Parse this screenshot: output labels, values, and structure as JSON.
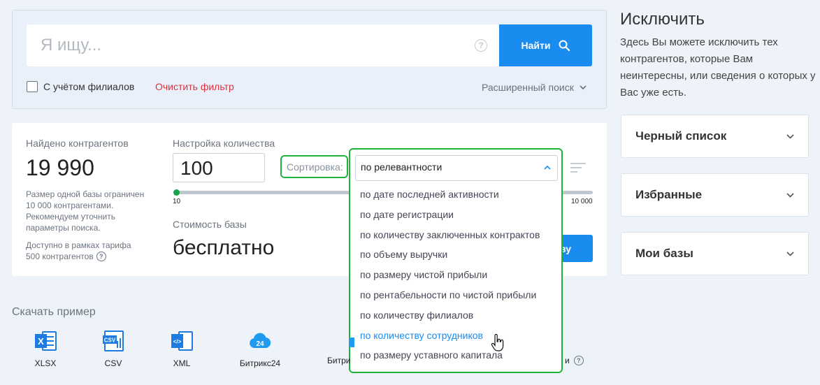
{
  "search": {
    "placeholder": "Я ищу...",
    "button_label": "Найти",
    "branches_label": "С учётом филиалов",
    "clear_filter_label": "Очистить фильтр",
    "advanced_label": "Расширенный поиск"
  },
  "results": {
    "found_label": "Найдено контрагентов",
    "found_count": "19 990",
    "limit_note": [
      "Размер одной базы ограничен",
      "10 000 контрагентами.",
      "Рекомендуем уточнить",
      "параметры поиска."
    ],
    "tariff_note": [
      "Доступно в рамках тарифа",
      "500 контрагентов"
    ],
    "qty_label": "Настройка количества",
    "qty_value": "100",
    "slider_min": "10",
    "slider_max": "10 000",
    "cost_label": "Стоимость базы",
    "cost_value": "бесплатно",
    "partial_button_text": "зу"
  },
  "sort": {
    "label": "Сортировка:",
    "selected": "по релевантности",
    "options": [
      "по дате последней активности",
      "по дате регистрации",
      "по количеству заключенных контрактов",
      "по объему выручки",
      "по размеру чистой прибыли",
      "по рентабельности по чистой прибыли",
      "по количеству филиалов",
      "по количеству сотрудников",
      "по размеру уставного капитала"
    ],
    "highlighted_index": 7,
    "highlight_color": "#1a8cf0"
  },
  "downloads": {
    "title": "Скачать пример",
    "items": [
      "XLSX",
      "CSV",
      "XML",
      "Битрикс24"
    ],
    "partial_left": "Битри",
    "partial_right": "и"
  },
  "exclude": {
    "title": "Исключить",
    "description": "Здесь Вы можете исключить тех контрагентов, которые Вам неинтересны, или сведения о которых у Вас уже есть.",
    "sections": [
      "Черный список",
      "Избранные",
      "Мои базы"
    ]
  },
  "colors": {
    "accent": "#1a8cf0",
    "highlight_box": "#1db33a",
    "danger": "#d9333f"
  }
}
